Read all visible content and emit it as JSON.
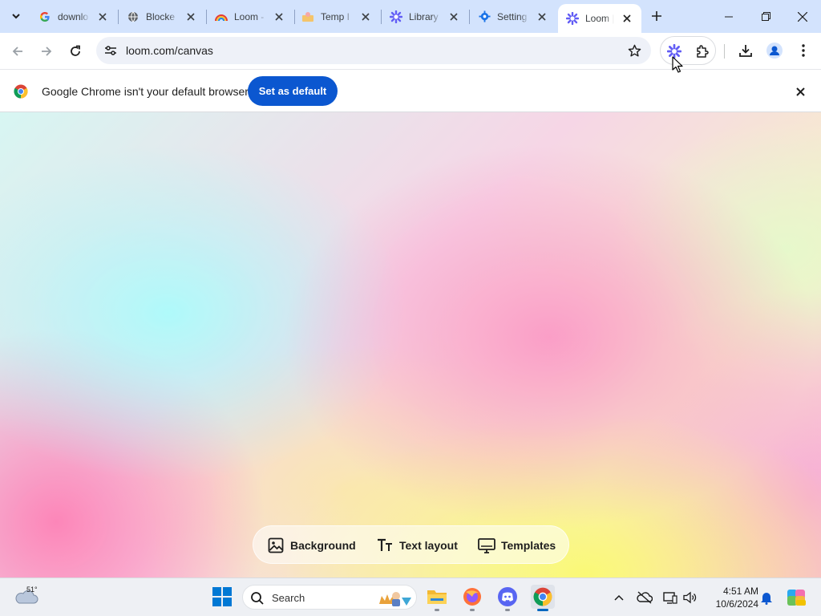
{
  "tabs": [
    {
      "title": "downlo",
      "icon": "google-icon"
    },
    {
      "title": "Blocke",
      "icon": "globe-icon"
    },
    {
      "title": "Loom -",
      "icon": "rainbow-icon"
    },
    {
      "title": "Temp I",
      "icon": "temp-mail-icon"
    },
    {
      "title": "Library",
      "icon": "loom-icon"
    },
    {
      "title": "Setting",
      "icon": "settings-gear-icon"
    },
    {
      "title": "Loom |",
      "icon": "loom-icon",
      "active": true
    }
  ],
  "toolbar": {
    "url": "loom.com/canvas"
  },
  "infobar": {
    "message": "Google Chrome isn't your default browser",
    "button_label": "Set as default"
  },
  "canvas": {
    "actions": [
      {
        "label": "Background",
        "icon": "image-icon"
      },
      {
        "label": "Text layout",
        "icon": "text-icon"
      },
      {
        "label": "Templates",
        "icon": "monitor-icon"
      }
    ]
  },
  "taskbar": {
    "weather_temp": "51°",
    "search_placeholder": "Search",
    "time": "4:51 AM",
    "date": "10/6/2024",
    "apps": [
      "windows-start-icon",
      "file-explorer-icon",
      "firefox-icon",
      "discord-icon",
      "chrome-icon"
    ]
  },
  "colors": {
    "accent": "#0b57d0",
    "tabstrip": "#d3e3fd",
    "loom_purple": "#625df5"
  }
}
